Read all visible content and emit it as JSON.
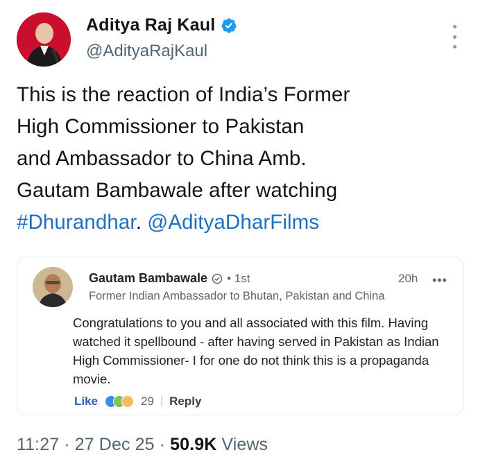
{
  "tweet": {
    "author": {
      "name": "Aditya Raj Kaul",
      "handle": "@AdityaRajKaul",
      "verified_icon": "verified-badge-icon",
      "verified_color": "#1d9bf0"
    },
    "text_plain": "This is the reaction of India’s Former\nHigh Commissioner to Pakistan\nand Ambassador to China Amb.\nGautam Bambawale after watching\n",
    "hashtag": "#Dhurandhar",
    "punct": ". ",
    "mention": "@AdityaDharFilms",
    "link_color": "#1d6fc4",
    "menu_icon": "more-vertical-icon"
  },
  "linkedin_comment": {
    "name": "Gautam Bambawale",
    "degree": "• 1st",
    "time": "20h",
    "menu_icon": "more-horizontal-icon",
    "headline": "Former Indian Ambassador to Bhutan, Pakistan and China",
    "body": "Congratulations to you and all associated with this film. Having watched it spellbound - after having served in Pakistan as Indian High Commissioner- I for one do not think this is a propaganda movie.",
    "like_label": "Like",
    "reaction_count": "29",
    "reply_label": "Reply",
    "like_color": "#2c5fb3"
  },
  "meta": {
    "time": "11:27",
    "dot1": " · ",
    "date": "27 Dec 25",
    "dot2": " · ",
    "views_count": "50.9K",
    "views_label": " Views"
  }
}
